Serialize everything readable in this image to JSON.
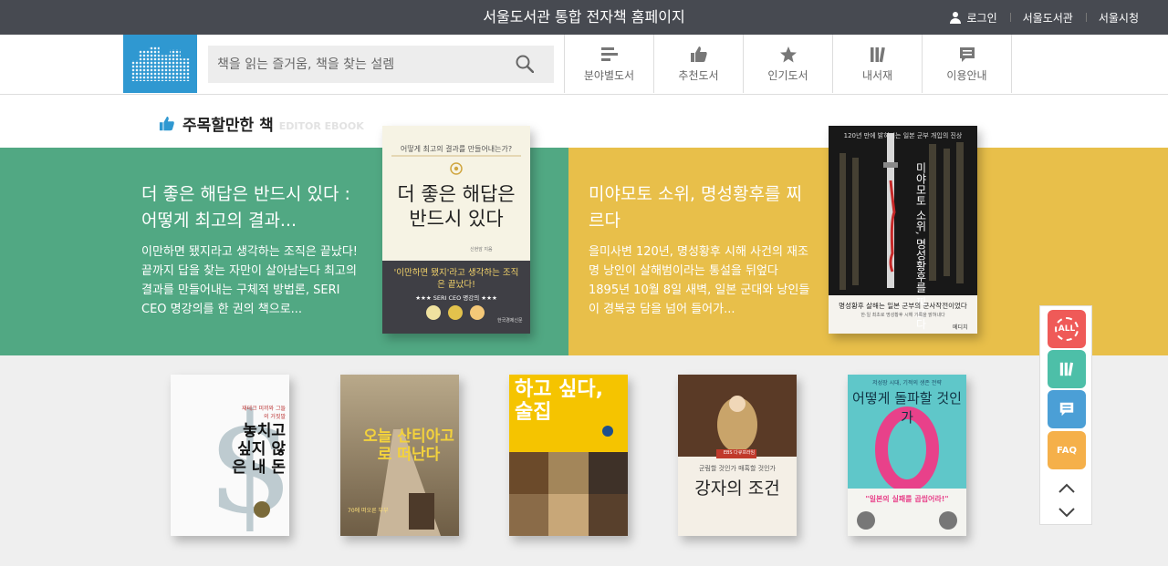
{
  "topbar": {
    "title": "서울도서관 통합 전자책 홈페이지",
    "login": "로그인",
    "library": "서울도서관",
    "city": "서울시청"
  },
  "header": {
    "search_placeholder": "책을 읽는 즐거움, 책을 찾는 설렘",
    "nav": [
      {
        "label": "분야별도서",
        "icon": "list-icon"
      },
      {
        "label": "추천도서",
        "icon": "thumbs-up-icon"
      },
      {
        "label": "인기도서",
        "icon": "star-icon"
      },
      {
        "label": "내서재",
        "icon": "bookshelf-icon"
      },
      {
        "label": "이용안내",
        "icon": "speech-bubble-icon"
      }
    ]
  },
  "section": {
    "title": "주목할만한 책",
    "subtitle": "EDITOR EBOOK"
  },
  "features": [
    {
      "title": "더 좋은 해답은 반드시 있다 : 어떻게 최고의 결과...",
      "description": "이만하면 됐지라고 생각하는 조직은 끝났다! 끝까지 답을 찾는 자만이 살아남는다 최고의 결과를 만들어내는 구체적 방법론, SERI CEO 명강의를 한 권의 책으로...",
      "cover": {
        "top": "어떻게 최고의 결과를 만들어내는가?",
        "main": "더 좋은 해답은 반드시 있다",
        "author": "신현암 지음",
        "band": "'이만하면 됐지'라고 생각하는 조직은 끝났다!",
        "band_sub": "★★★ SERI CEO 명강의 ★★★",
        "publisher": "한국경제신문"
      },
      "color": "#51a883"
    },
    {
      "title": "미야모토 소위, 명성황후를 찌르다",
      "description": "을미사변 120년, 명성황후 시해 사건의 재조명 낭인이 살해범이라는 통설을 뒤엎다 1895년 10월 8일 새벽, 일본 군대와 낭인들이 경복궁 담을 넘어 들어가...",
      "cover": {
        "top": "120년 만에 밝혀지는 일본 군부 개입의 진상",
        "main": "미야모토 소위, 명성황후를 찌르다",
        "band": "명성황후 살해는 일본 군부의 군사작전이었다",
        "band_sub": "한·일 최초로 명성황후 시해 기록을 밝혀내다",
        "publisher": "메디치"
      },
      "color": "#e8bf4a"
    }
  ],
  "books": [
    {
      "title": "놓치고 싶지 않은 내 돈",
      "tag": "재테크 미끼와 그들의 거짓말"
    },
    {
      "title": "오늘 산티아고로 떠난다",
      "tag": "70에 떠오른 부부"
    },
    {
      "title": "하고 싶다, 술집",
      "tag": ""
    },
    {
      "title": "강자의 조건",
      "tag": "군림할 것인가 매혹할 것인가",
      "badge": "EBS 다큐프라임"
    },
    {
      "title": "어떻게 돌파할 것인가",
      "tag": "저성장 시대, 기적의 생존 전략",
      "band": "\"일본의 실패를 곱씹어라!\""
    }
  ],
  "quick_menu": {
    "all": "ALL",
    "faq": "FAQ"
  }
}
